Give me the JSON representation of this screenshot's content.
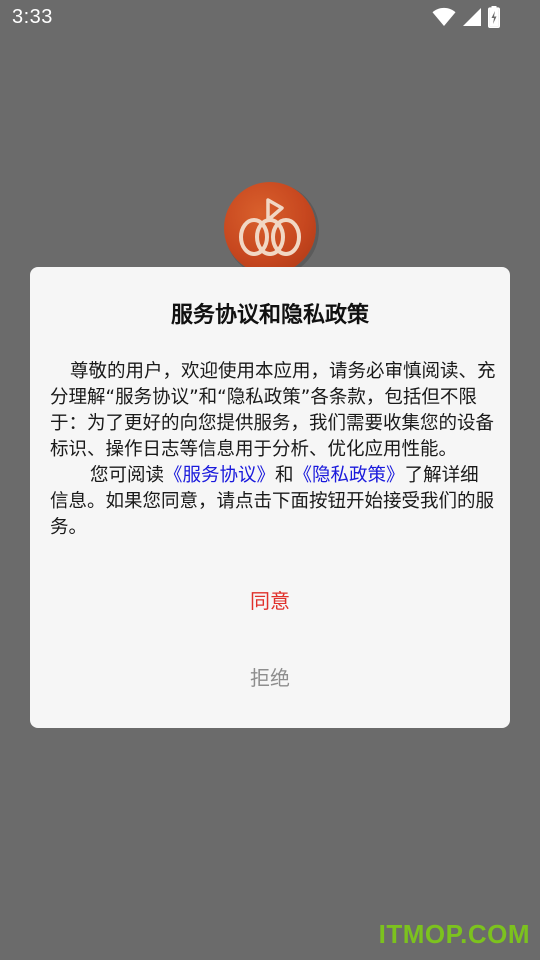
{
  "status_bar": {
    "time": "3:33",
    "icons": [
      "wifi-icon",
      "cellular-signal-icon",
      "battery-charging-icon"
    ]
  },
  "app": {
    "logo_icon": "pumpkin-play-logo",
    "logo_color": "#c7471f"
  },
  "dialog": {
    "title": "服务协议和隐私政策",
    "paragraph1": "尊敬的用户，欢迎使用本应用，请务必审慎阅读、充分理解“服务协议”和“隐私政策”各条款，包括但不限于：为了更好的向您提供服务，我们需要收集您的设备标识、操作日志等信息用于分析、优化应用性能。",
    "paragraph2_prefix": "您可阅读",
    "service_agreement_link": "《服务协议》",
    "and_text": "和",
    "privacy_policy_link": "《隐私政策》",
    "paragraph2_suffix": "了解详细信息。如果您同意，请点击下面按钮开始接受我们的服务。",
    "agree_label": "同意",
    "reject_label": "拒绝"
  },
  "colors": {
    "agree": "#e0302a",
    "link": "#1a1adc",
    "reject": "#8e8e8e",
    "overlay": "#6b6b6b"
  },
  "watermark": "ITMOP.COM"
}
